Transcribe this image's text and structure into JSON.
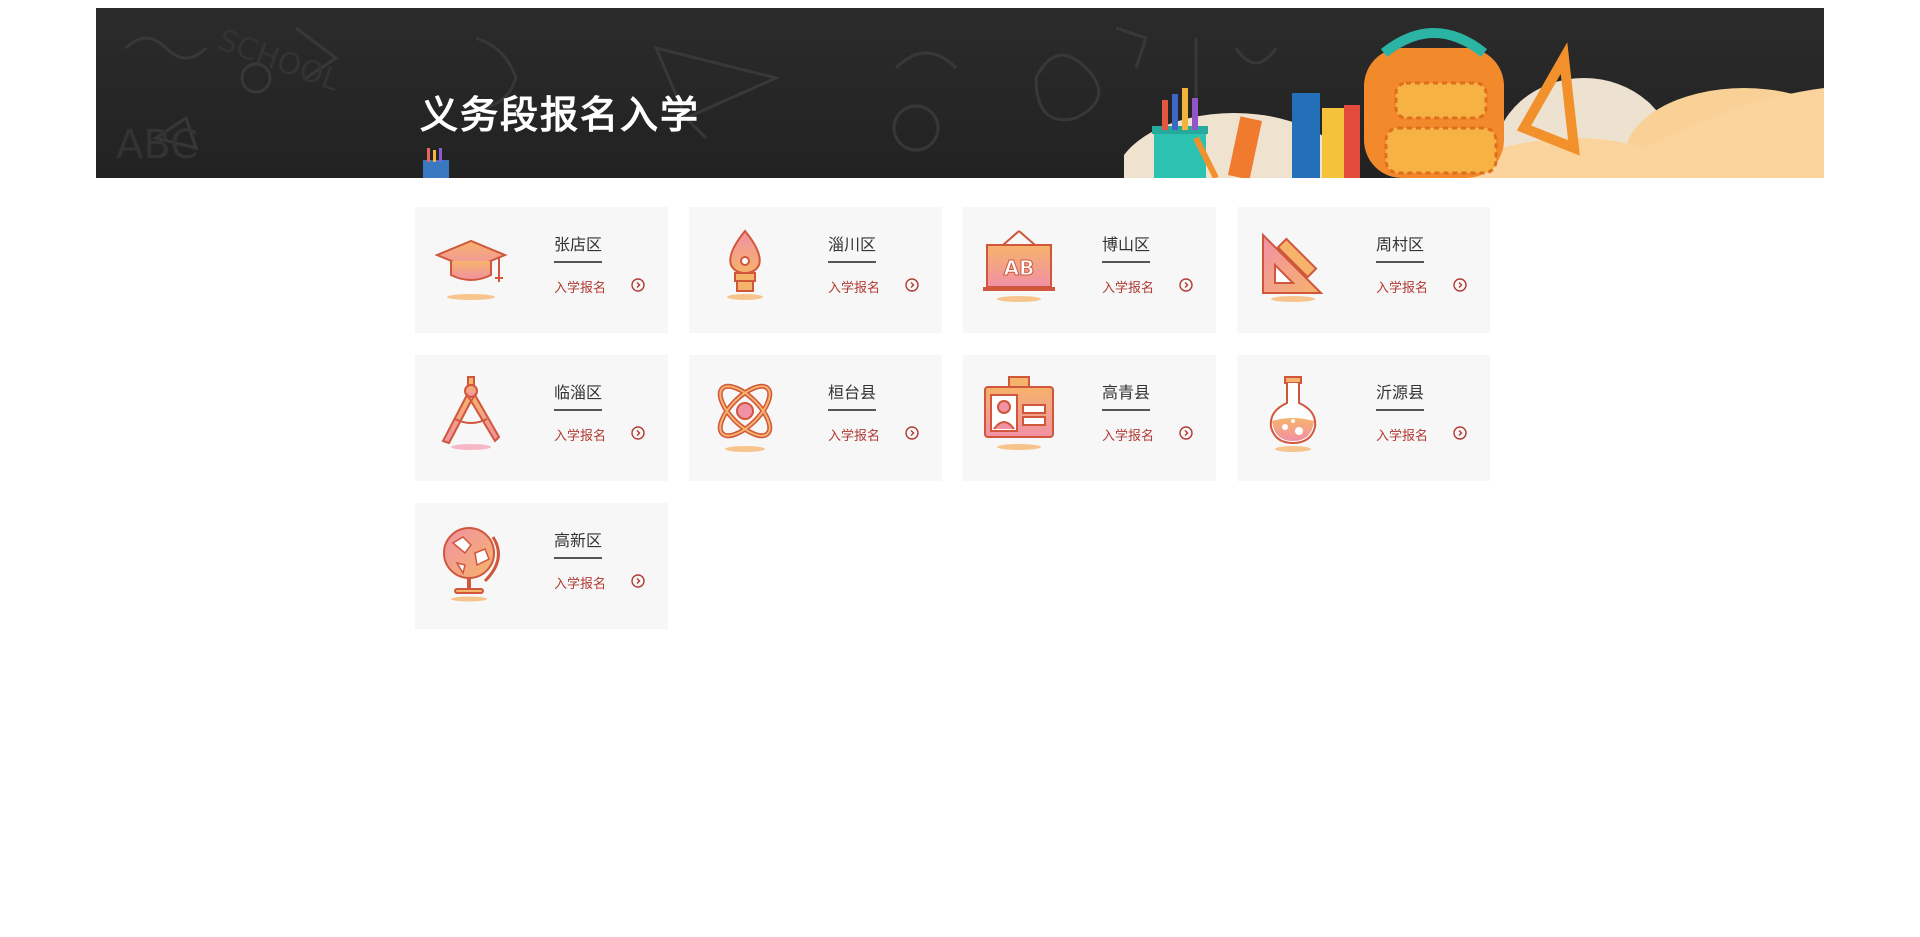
{
  "banner": {
    "title": "义务段报名入学"
  },
  "districts": [
    {
      "name": "张店区",
      "action": "入学报名",
      "icon": "graduation-cap-icon"
    },
    {
      "name": "淄川区",
      "action": "入学报名",
      "icon": "pen-nib-icon"
    },
    {
      "name": "博山区",
      "action": "入学报名",
      "icon": "ab-blackboard-icon"
    },
    {
      "name": "周村区",
      "action": "入学报名",
      "icon": "set-square-ruler-icon"
    },
    {
      "name": "临淄区",
      "action": "入学报名",
      "icon": "drawing-compass-icon"
    },
    {
      "name": "桓台县",
      "action": "入学报名",
      "icon": "atom-icon"
    },
    {
      "name": "高青县",
      "action": "入学报名",
      "icon": "id-card-icon"
    },
    {
      "name": "沂源县",
      "action": "入学报名",
      "icon": "flask-icon"
    },
    {
      "name": "高新区",
      "action": "入学报名",
      "icon": "globe-icon"
    }
  ],
  "colors": {
    "banner_bg": "#262626",
    "card_bg": "#f7f7f7",
    "link": "#b03a33",
    "icon_stroke": "#d0573c",
    "icon_fill_top": "#f6b36a",
    "icon_fill_bottom": "#f191a6"
  }
}
